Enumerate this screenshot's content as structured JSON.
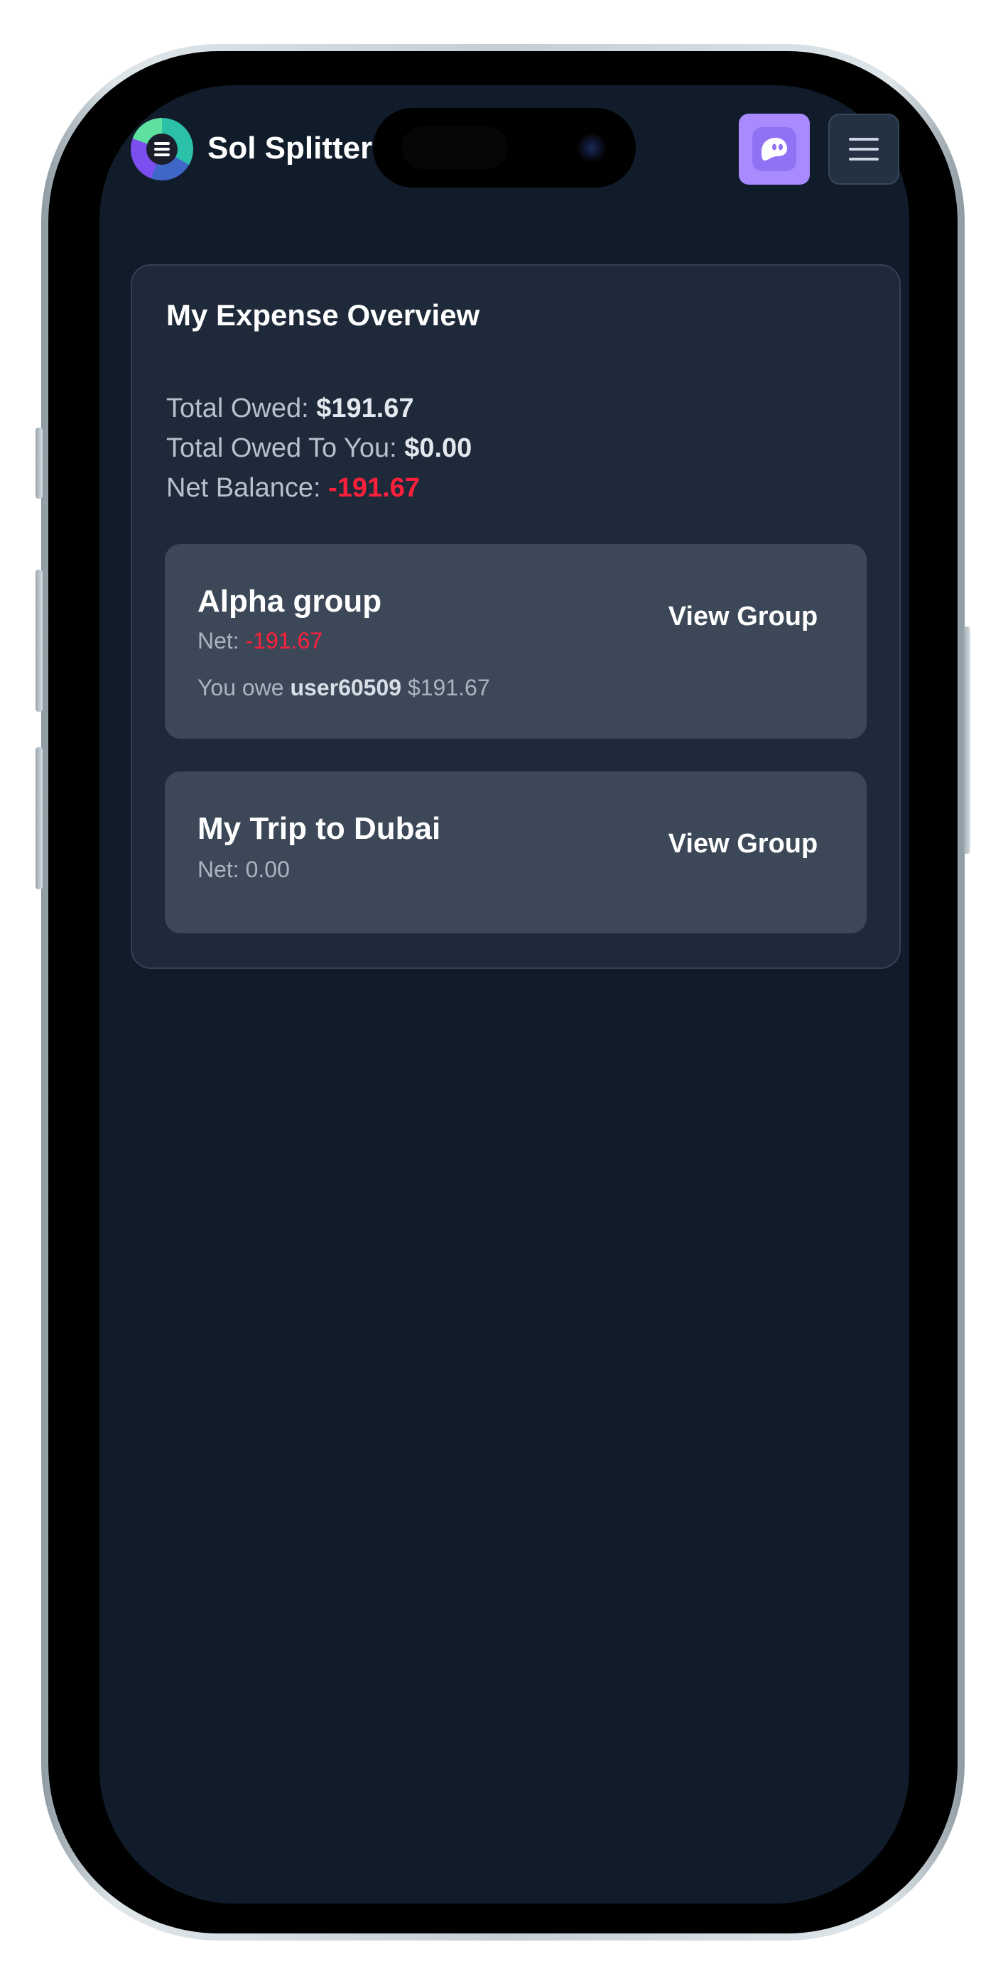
{
  "header": {
    "app_title": "Sol Splitter",
    "logo_icon": "sol-splitter-logo-icon",
    "wallet_icon": "phantom-ghost-icon",
    "menu_icon": "hamburger-menu-icon"
  },
  "overview": {
    "title": "My Expense Overview",
    "total_owed_label": "Total Owed: ",
    "total_owed_value": "$191.67",
    "total_owed_to_you_label": "Total Owed To You: ",
    "total_owed_to_you_value": "$0.00",
    "net_balance_label": "Net Balance: ",
    "net_balance_value": "-191.67"
  },
  "groups": [
    {
      "name": "Alpha group",
      "net_label": "Net: ",
      "net_value": "-191.67",
      "owe_prefix": "You owe ",
      "owe_user": "user60509",
      "owe_amount": " $191.67",
      "button_label": "View Group"
    },
    {
      "name": "My Trip to Dubai",
      "net_label": "Net: ",
      "net_value": "0.00",
      "button_label": "View Group"
    }
  ],
  "colors": {
    "background": "#111c2b",
    "card": "#1e2a3a",
    "group_card": "#3c4858",
    "negative": "#ff1f3a",
    "accent_purple": "#a98bff"
  }
}
